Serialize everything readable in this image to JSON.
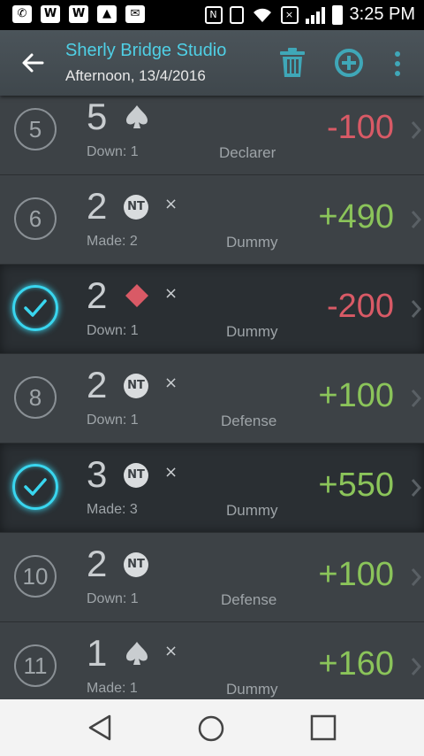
{
  "status_bar": {
    "time": "3:25 PM",
    "left_icons": [
      "whatsapp-icon",
      "w-icon",
      "w-icon",
      "image-icon",
      "mail-icon"
    ],
    "right_icons": [
      "nfc-icon",
      "vibrate-icon",
      "wifi-icon",
      "no-sim-icon",
      "signal-icon",
      "battery-icon"
    ]
  },
  "appbar": {
    "title": "Sherly Bridge Studio",
    "subtitle": "Afternoon, 13/4/2016",
    "accent_color": "#4fd0e6"
  },
  "colors": {
    "positive": "#8bc45a",
    "negative": "#d95a66",
    "selected": "#39d6ef"
  },
  "boards": [
    {
      "number": "5",
      "selected": false,
      "level": "5",
      "suit": "spade",
      "doubled": "",
      "result": "Down: 1",
      "role": "Declarer",
      "score": "-100"
    },
    {
      "number": "6",
      "selected": false,
      "level": "2",
      "suit": "NT",
      "doubled": "×",
      "result": "Made: 2",
      "role": "Dummy",
      "score": "+490"
    },
    {
      "number": "7",
      "selected": true,
      "level": "2",
      "suit": "diamond",
      "doubled": "×",
      "result": "Down: 1",
      "role": "Dummy",
      "score": "-200"
    },
    {
      "number": "8",
      "selected": false,
      "level": "2",
      "suit": "NT",
      "doubled": "×",
      "result": "Down: 1",
      "role": "Defense",
      "score": "+100"
    },
    {
      "number": "9",
      "selected": true,
      "level": "3",
      "suit": "NT",
      "doubled": "×",
      "result": "Made: 3",
      "role": "Dummy",
      "score": "+550"
    },
    {
      "number": "10",
      "selected": false,
      "level": "2",
      "suit": "NT",
      "doubled": "",
      "result": "Down: 1",
      "role": "Defense",
      "score": "+100"
    },
    {
      "number": "11",
      "selected": false,
      "level": "1",
      "suit": "spade",
      "doubled": "×",
      "result": "Made: 1",
      "role": "Dummy",
      "score": "+160"
    }
  ],
  "nt_label": "NT",
  "navbar": [
    "back-icon",
    "home-icon",
    "recents-icon"
  ]
}
